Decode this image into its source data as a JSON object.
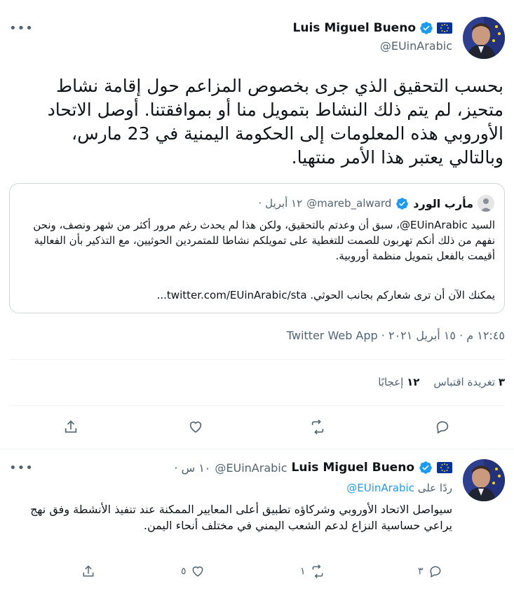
{
  "main_tweet": {
    "author_name": "Luis Miguel Bueno",
    "author_handle": "@EUinArabic",
    "text": "بحسب التحقيق الذي جرى بخصوص المزاعم حول إقامة نشاط متحيز، لم يتم ذلك النشاط بتمويل منا أو بموافقتنا. أوصل الاتحاد الأوروبي هذه المعلومات إلى الحكومة اليمنية في 23 مارس، وبالتالي يعتبر هذا الأمر منتهيا.",
    "timestamp": "١٢:٤٥ م · ١٥ أبريل ٢٠٢١ · Twitter Web App",
    "retweets_count": "٣",
    "retweets_label": "تغريدة اقتباس",
    "likes_count": "١٢",
    "likes_label": "إعجابًا"
  },
  "quoted_tweet": {
    "author_name": "مأرب الورد",
    "author_handle": "@mareb_alward",
    "date": "١٢ أبريل ·",
    "text": "السيد EUinArabic@، سبق أن وعدتم بالتحقيق، ولكن هذا لم يحدث رغم مرور أكثر من شهر ونصف، ونحن نفهم من ذلك أنكم تهربون للصمت للتغطية على تمويلكم نشاطا للمتمردين الحوثيين، مع التذكير بأن الفعالية أقيمت بالفعل بتمويل منظمة أوروبية.",
    "text2": "يمكنك الآن أن ترى شعاركم بجانب الحوثي. twitter.com/EUinArabic/sta..."
  },
  "reply_tweet": {
    "author_name": "Luis Miguel Bueno",
    "author_handle": "@EUinArabic",
    "time": "١٠ س ·",
    "replying_prefix": "ردًا على",
    "replying_to": "@EUinArabic",
    "text": "سيواصل الاتحاد الأوروبي وشركاؤه تطبيق أعلى المعايير الممكنة عند تنفيذ الأنشطة وفق نهج يراعي حساسية النزاع لدعم الشعب اليمني في مختلف أنحاء اليمن.",
    "reply_count": "٣",
    "retweet_count": "١",
    "like_count": "٥"
  },
  "colors": {
    "accent": "#1d9bf0",
    "text_secondary": "#536471",
    "border": "#cfd9de"
  },
  "icons": {
    "more": "more-horizontal-icon",
    "verified": "verified-badge-icon",
    "flag": "eu-flag-icon",
    "reply": "reply-icon",
    "retweet": "retweet-icon",
    "like": "heart-icon",
    "share": "share-icon"
  }
}
